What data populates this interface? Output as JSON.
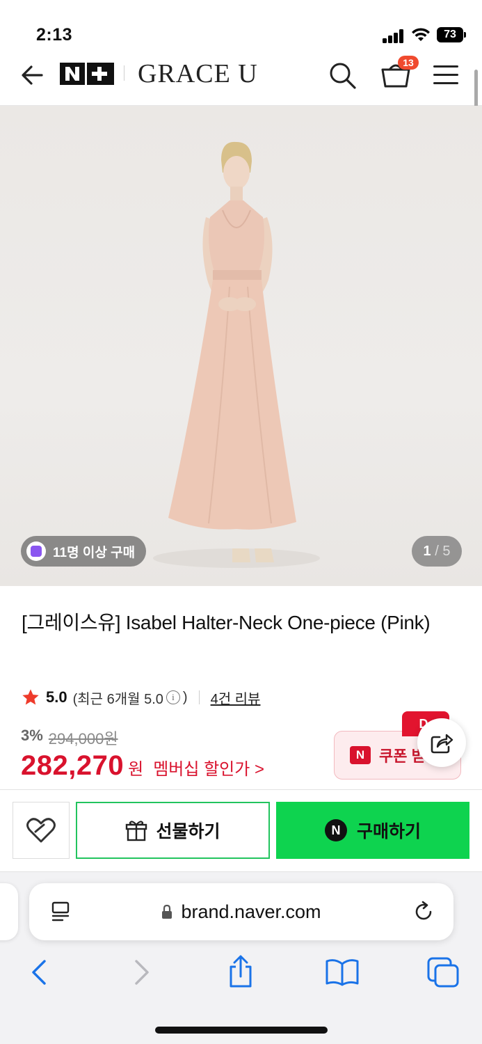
{
  "status_bar": {
    "time": "2:13",
    "battery": "73"
  },
  "header": {
    "back_icon": "arrow-left-icon",
    "nplus_label": "N+",
    "brand": "GRACE U",
    "search_icon": "search-icon",
    "cart_icon": "cart-icon",
    "cart_badge": "13",
    "menu_icon": "hamburger-menu-icon"
  },
  "gallery": {
    "buyers_badge": "11명 이상 구매",
    "page_current": "1",
    "page_sep": "/",
    "page_total": "5"
  },
  "product": {
    "title": "[그레이스유] Isabel Halter-Neck One-piece (Pink)",
    "rating": "5.0",
    "rating_recent_prefix": "(최근 6개월 5.0",
    "rating_recent_suffix": ")",
    "review_link": "4건 리뷰",
    "discount_rate": "3%",
    "original_price": "294,000원",
    "sale_price": "282,270",
    "currency": "원",
    "member_price_link": "멤버십 할인가 >",
    "coupon_label": "쿠폰 받",
    "coupon_tag": "D-"
  },
  "actions": {
    "wish_icon": "heart-icon",
    "gift_label": "선물하기",
    "buy_label": "구매하기",
    "npay_badge": "N"
  },
  "browser": {
    "url": "brand.naver.com",
    "icons": [
      "reader-icon",
      "lock-icon",
      "reload-icon",
      "chevron-left-icon",
      "chevron-right-icon",
      "share-icon",
      "bookmarks-icon",
      "tabs-icon"
    ]
  },
  "colors": {
    "price_red": "#d9122d",
    "buy_green": "#0ed34f",
    "gift_border": "#22c45e",
    "coupon_bg": "#fdecee",
    "badge_orange": "#f04a2e"
  }
}
